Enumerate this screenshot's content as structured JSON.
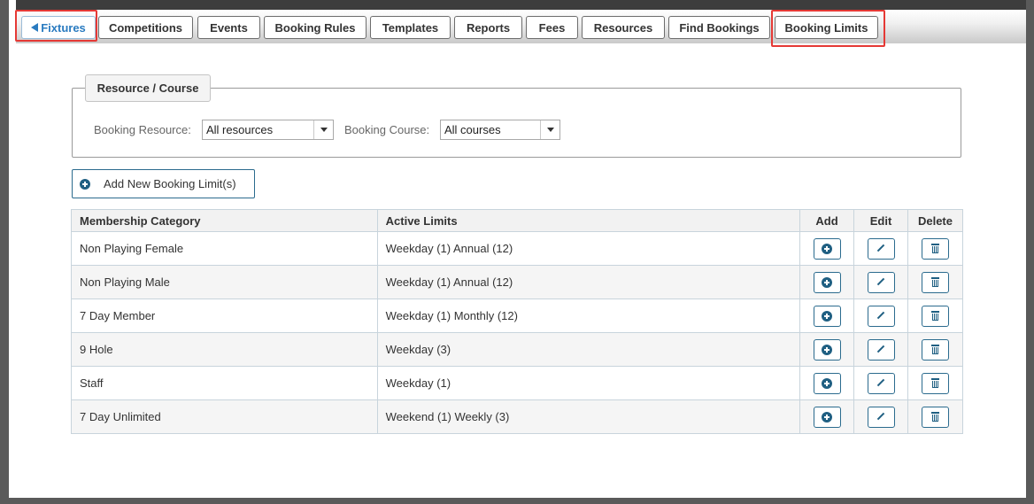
{
  "nav": {
    "back_tab": "Fixtures",
    "tabs": [
      "Competitions",
      "Events",
      "Booking Rules",
      "Templates",
      "Reports",
      "Fees",
      "Resources",
      "Find Bookings",
      "Booking Limits"
    ]
  },
  "filter": {
    "legend": "Resource / Course",
    "resource_label": "Booking Resource:",
    "resource_value": "All resources",
    "course_label": "Booking Course:",
    "course_value": "All courses"
  },
  "add_button_label": "Add New Booking Limit(s)",
  "table": {
    "headers": [
      "Membership Category",
      "Active Limits",
      "Add",
      "Edit",
      "Delete"
    ],
    "rows": [
      {
        "category": "Non Playing Female",
        "limits": "Weekday (1) Annual (12)"
      },
      {
        "category": "Non Playing Male",
        "limits": "Weekday (1) Annual (12)"
      },
      {
        "category": "7 Day Member",
        "limits": "Weekday (1) Monthly (12)"
      },
      {
        "category": "9 Hole",
        "limits": "Weekday (3)"
      },
      {
        "category": "Staff",
        "limits": "Weekday (1)"
      },
      {
        "category": "7 Day Unlimited",
        "limits": "Weekend (1) Weekly (3)"
      }
    ]
  },
  "icons": {
    "back": "triangle-left-icon",
    "add": "plus-circle-icon",
    "edit": "pencil-icon",
    "delete": "trash-icon",
    "dropdown": "chevron-down-icon"
  },
  "colors": {
    "accent": "#1f5f82",
    "highlight": "#e53935",
    "link": "#2a7bc0"
  }
}
